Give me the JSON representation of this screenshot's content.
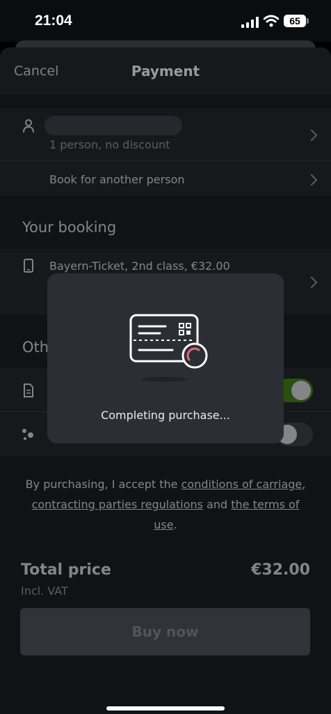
{
  "status_bar": {
    "time": "21:04",
    "battery": "65"
  },
  "nav": {
    "cancel_label": "Cancel",
    "title": "Payment"
  },
  "traveller": {
    "summary": "1 person, no discount",
    "book_other_label": "Book for another person"
  },
  "booking": {
    "heading": "Your booking",
    "ticket": "Bayern-Ticket, 2nd class, €32.00"
  },
  "other": {
    "heading_visible": "Oth",
    "toggle_1_on": true,
    "toggle_2_on": false
  },
  "modal": {
    "message": "Completing purchase..."
  },
  "legal": {
    "prefix": "By purchasing, I accept the ",
    "link_carriage": "conditions of carriage",
    "comma": ",",
    "link_parties": "contracting parties regulations",
    "and": " and ",
    "link_terms": "the terms of use",
    "period": "."
  },
  "total": {
    "label": "Total price",
    "value": "€32.00",
    "vat": "Incl. VAT"
  },
  "buy_label": "Buy now",
  "colors": {
    "toggle_on": "#3f7d14",
    "background": "#1a1e23",
    "card": "#22262b"
  }
}
